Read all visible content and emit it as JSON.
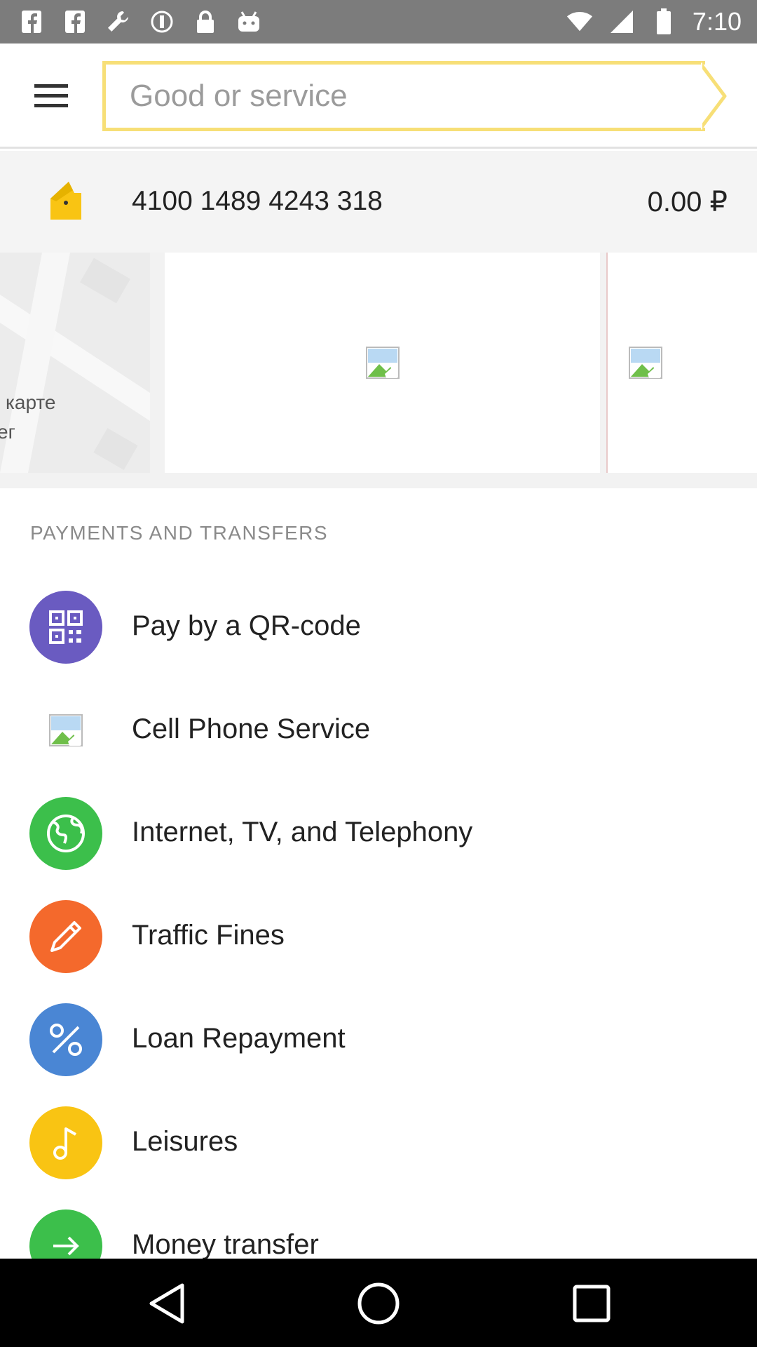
{
  "status_bar": {
    "time": "7:10",
    "left_icons": [
      "facebook-icon",
      "facebook-icon",
      "wrench-icon",
      "sync-icon",
      "lock-icon",
      "android-icon"
    ],
    "right_icons": [
      "wifi-icon",
      "signal-icon",
      "battery-icon"
    ]
  },
  "header": {
    "menu_icon": "hamburger-menu-icon",
    "search": {
      "placeholder": "Good or service",
      "value": ""
    },
    "accent_color": "#f7df77"
  },
  "account": {
    "icon": "wallet-icon",
    "number": "4100 1489 4243 318",
    "balance": "0.00 ₽"
  },
  "cards": {
    "map_card_text_1": "карте",
    "map_card_text_2": "ег",
    "promos": [
      "broken-image-icon",
      "broken-image-icon"
    ]
  },
  "payments": {
    "section_title": "PAYMENTS AND TRANSFERS",
    "items": [
      {
        "label": "Pay by a QR-code",
        "icon": "qr-code-icon",
        "color": "#6a5bc1"
      },
      {
        "label": "Cell Phone Service",
        "icon": "broken-image-icon",
        "color": "#ffffff"
      },
      {
        "label": "Internet, TV, and Telephony",
        "icon": "globe-icon",
        "color": "#3cbf4b"
      },
      {
        "label": "Traffic Fines",
        "icon": "pencil-icon",
        "color": "#f4692c"
      },
      {
        "label": "Loan Repayment",
        "icon": "percent-icon",
        "color": "#4a86d4"
      },
      {
        "label": "Leisures",
        "icon": "music-note-icon",
        "color": "#f9c413"
      },
      {
        "label": "Money transfer",
        "icon": "arrow-right-icon",
        "color": "#3cbf4b"
      }
    ]
  },
  "nav_bar": {
    "back": "back-icon",
    "home": "home-icon",
    "recents": "recents-icon"
  }
}
